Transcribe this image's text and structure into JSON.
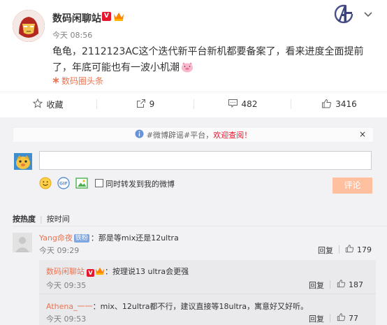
{
  "post": {
    "author": "数码闲聊站",
    "v_badge": "V",
    "time": "今天 08:56",
    "content": "龟龟，2112123AC这个迭代新平台新机都要备案了，看来进度全面提前了，年底可能也有一波小机潮",
    "topic_label": "数码圈头条"
  },
  "actions": {
    "favorite": "收藏",
    "forward_count": "9",
    "comment_count": "482",
    "like_count": "3416"
  },
  "notice": {
    "prefix": "#微博辟谣#平台，",
    "highlight": "欢迎查阅！",
    "close": "×"
  },
  "composer": {
    "input_value": "",
    "forward_label": "同时转发到我的微博",
    "submit_label": "评论"
  },
  "sort": {
    "active": "按热度",
    "other": "按时间"
  },
  "comments": [
    {
      "author": "Yang命夜",
      "badge": "铁粉",
      "text": "：那是等mix还是12ultra",
      "time": "今天 09:29",
      "reply": "回复",
      "likes": "179"
    }
  ],
  "replies": [
    {
      "author": "数码闲聊站",
      "v_badge": "V",
      "text": "：按理说13 ultra会更强",
      "time": "今天 09:35",
      "reply": "回复",
      "likes": "187"
    },
    {
      "author": "Athena_一一",
      "text": "：mix、12ultra都不行，建议直接等18ultra，寓意好又好听。",
      "time": "今天 09:53",
      "reply": "回复",
      "likes": "77"
    }
  ],
  "colors": {
    "accent": "#eb7350",
    "submit_bg": "#ffc09f",
    "v_badge": "#e6162d",
    "comments_bg": "#f2f2f5"
  }
}
